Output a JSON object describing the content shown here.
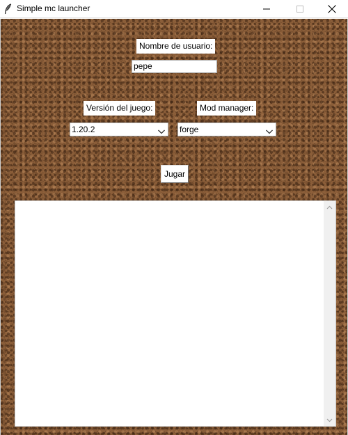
{
  "window": {
    "title": "Simple mc launcher",
    "icon": "feather-icon"
  },
  "form": {
    "username_label": "Nombre de usuario:",
    "username_value": "pepe",
    "version_label": "Versión del juego:",
    "version_value": "1.20.2",
    "modmanager_label": "Mod manager:",
    "modmanager_value": "forge",
    "play_button": "Jugar"
  },
  "log": {
    "content": ""
  },
  "colors": {
    "background_texture": "#8a5d38"
  }
}
